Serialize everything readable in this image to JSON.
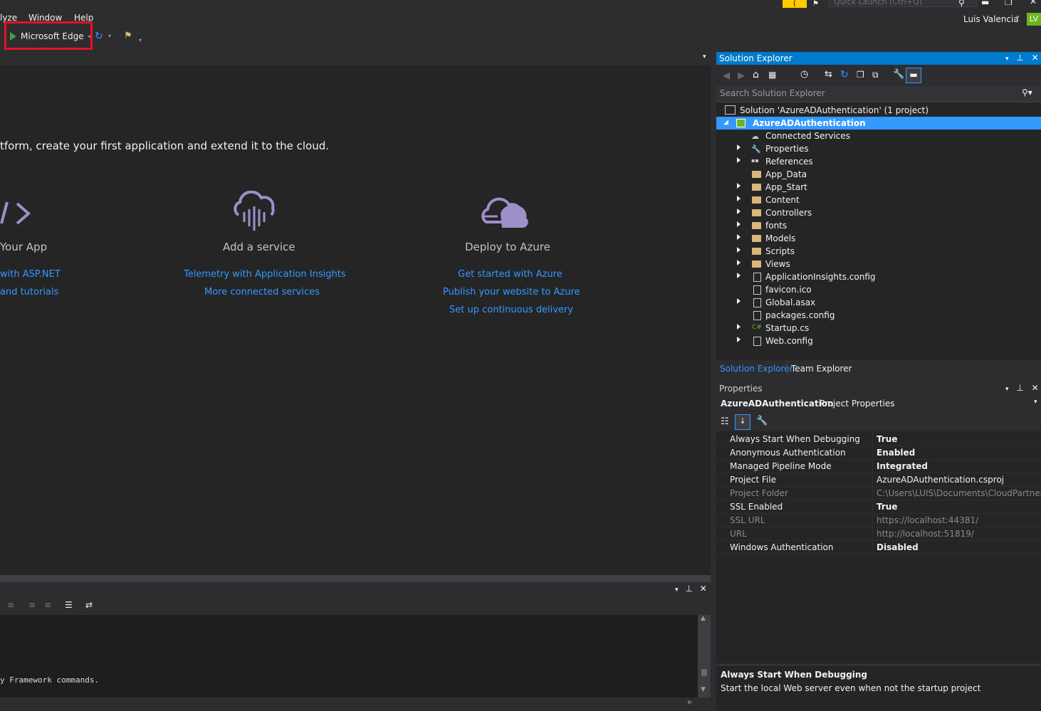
{
  "menu": {
    "items": [
      "lyze",
      "Window",
      "Help"
    ]
  },
  "titlebar": {
    "feedback_icon": "feedback-smiley-icon",
    "quick_launch_placeholder": "Quick Launch (Ctrl+Q)",
    "user_name": "Luis Valencia",
    "avatar_initials": "LV"
  },
  "toolbar": {
    "run_target": "Microsoft Edge"
  },
  "start_page": {
    "subtitle": "tform, create your first application and extend it to the cloud.",
    "cards": [
      {
        "icon": "code-brackets-icon",
        "title": "Your App",
        "links": [
          "with ASP.NET",
          "and tutorials"
        ]
      },
      {
        "icon": "cloud-service-icon",
        "title": "Add a service",
        "links": [
          "Telemetry with Application Insights",
          "More connected services"
        ]
      },
      {
        "icon": "cloud-azure-icon",
        "title": "Deploy to Azure",
        "links": [
          "Get started with Azure",
          "Publish your website to Azure",
          "Set up continuous delivery"
        ]
      }
    ]
  },
  "output": {
    "text": "y Framework commands."
  },
  "solution_explorer": {
    "title": "Solution Explorer",
    "search_placeholder": "Search Solution Explorer",
    "solution_label": "Solution 'AzureADAuthentication' (1 project)",
    "project_label": "AzureADAuthentication",
    "items": [
      {
        "label": "Connected Services",
        "kind": "connected",
        "expandable": false
      },
      {
        "label": "Properties",
        "kind": "wrench",
        "expandable": true
      },
      {
        "label": "References",
        "kind": "refs",
        "expandable": true
      },
      {
        "label": "App_Data",
        "kind": "folder",
        "expandable": false
      },
      {
        "label": "App_Start",
        "kind": "folder",
        "expandable": true
      },
      {
        "label": "Content",
        "kind": "folder",
        "expandable": true
      },
      {
        "label": "Controllers",
        "kind": "folder",
        "expandable": true
      },
      {
        "label": "fonts",
        "kind": "folder",
        "expandable": true
      },
      {
        "label": "Models",
        "kind": "folder",
        "expandable": true
      },
      {
        "label": "Scripts",
        "kind": "folder",
        "expandable": true
      },
      {
        "label": "Views",
        "kind": "folder",
        "expandable": true
      },
      {
        "label": "ApplicationInsights.config",
        "kind": "config",
        "expandable": true
      },
      {
        "label": "favicon.ico",
        "kind": "file",
        "expandable": false
      },
      {
        "label": "Global.asax",
        "kind": "config",
        "expandable": true
      },
      {
        "label": "packages.config",
        "kind": "config",
        "expandable": false
      },
      {
        "label": "Startup.cs",
        "kind": "csharp",
        "expandable": true
      },
      {
        "label": "Web.config",
        "kind": "config",
        "expandable": true
      }
    ],
    "tabs": [
      "Solution Explorer",
      "Team Explorer"
    ]
  },
  "properties": {
    "title": "Properties",
    "object_name": "AzureADAuthentication",
    "object_type": "Project Properties",
    "rows": [
      {
        "name": "Always Start When Debugging",
        "value": "True",
        "bold": true,
        "dim": false
      },
      {
        "name": "Anonymous Authentication",
        "value": "Enabled",
        "bold": true,
        "dim": false
      },
      {
        "name": "Managed Pipeline Mode",
        "value": "Integrated",
        "bold": true,
        "dim": false
      },
      {
        "name": "Project File",
        "value": "AzureADAuthentication.csproj",
        "bold": false,
        "dim": false
      },
      {
        "name": "Project Folder",
        "value": "C:\\Users\\LUIS\\Documents\\CloudPartnerLab",
        "bold": false,
        "dim": true
      },
      {
        "name": "SSL Enabled",
        "value": "True",
        "bold": true,
        "dim": false
      },
      {
        "name": "SSL URL",
        "value": "https://localhost:44381/",
        "bold": false,
        "dim": true
      },
      {
        "name": "URL",
        "value": "http://localhost:51819/",
        "bold": false,
        "dim": true
      },
      {
        "name": "Windows Authentication",
        "value": "Disabled",
        "bold": true,
        "dim": false
      }
    ],
    "description_title": "Always Start When Debugging",
    "description_text": "Start the local Web server even when not the startup project"
  }
}
